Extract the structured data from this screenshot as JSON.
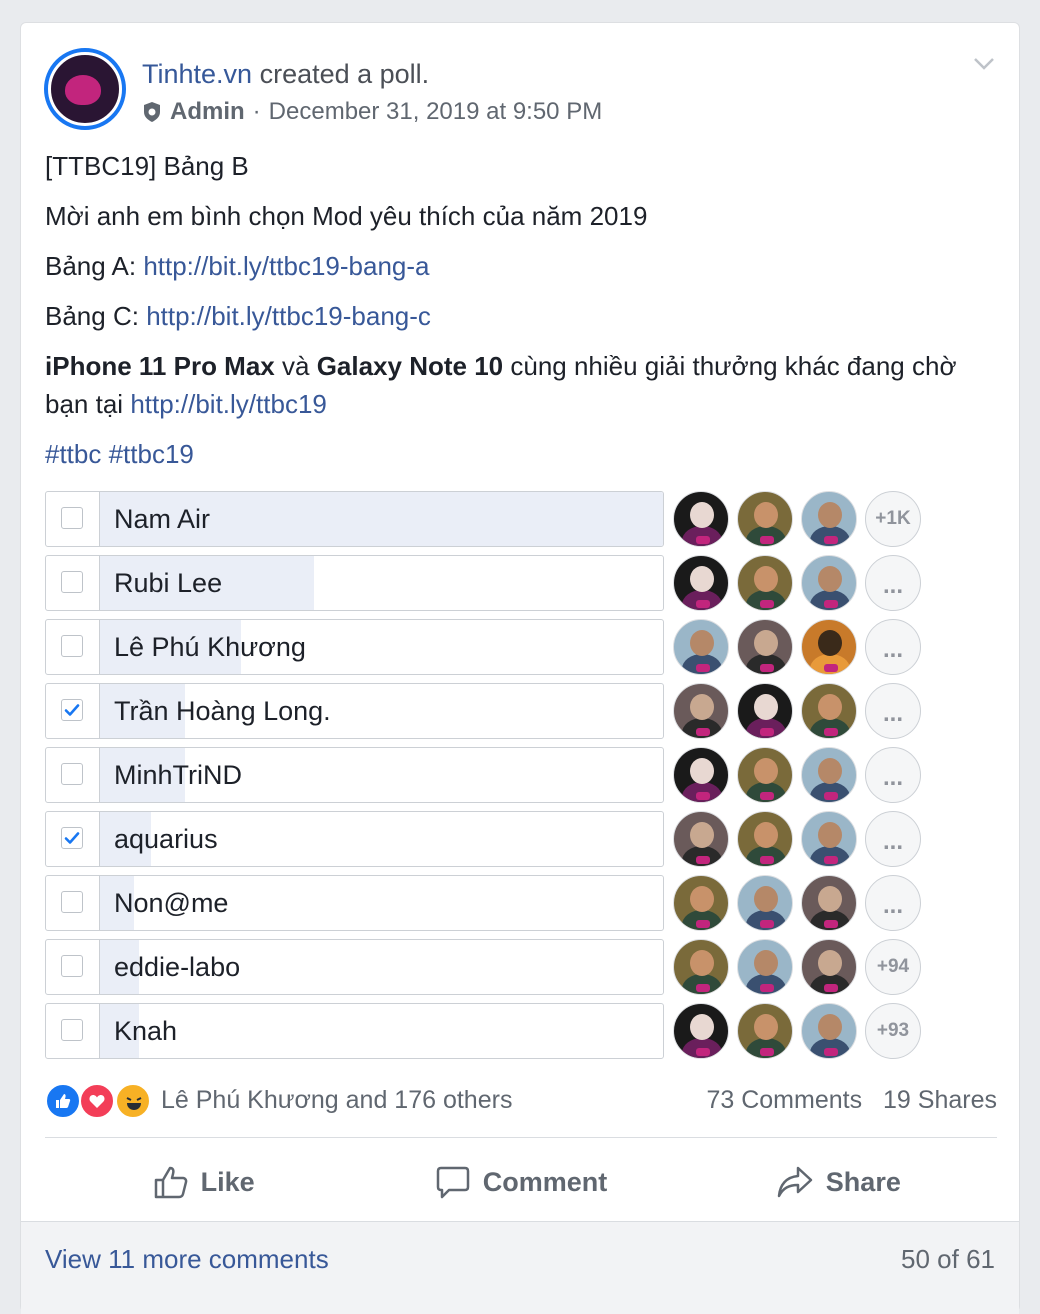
{
  "post": {
    "page_name": "Tinhte.vn",
    "action": "created a poll.",
    "role": "Admin",
    "separator": "·",
    "timestamp": "December 31, 2019 at 9:50 PM",
    "lines": {
      "title": "[TTBC19] Bảng B",
      "intro": "Mời anh em bình chọn Mod yêu thích của năm 2019",
      "bang_a_label": "Bảng A:",
      "bang_a_link": "http://bit.ly/ttbc19-bang-a",
      "bang_c_label": "Bảng C:",
      "bang_c_link": "http://bit.ly/ttbc19-bang-c",
      "prize_bold1": "iPhone 11 Pro Max",
      "prize_and": "và",
      "prize_bold2": "Galaxy Note 10",
      "prize_rest": "cùng nhiều giải thưởng khác đang chờ bạn tại",
      "prize_link": "http://bit.ly/ttbc19",
      "hashtags": "#ttbc #ttbc19"
    }
  },
  "poll": {
    "options": [
      {
        "label": "Nam Air",
        "checked": false,
        "share": 1.0,
        "more": "+1K"
      },
      {
        "label": "Rubi Lee",
        "checked": false,
        "share": 0.38,
        "more": "..."
      },
      {
        "label": "Lê Phú Khương",
        "checked": false,
        "share": 0.25,
        "more": "..."
      },
      {
        "label": "Trần Hoàng Long.",
        "checked": true,
        "share": 0.15,
        "more": "..."
      },
      {
        "label": "MinhTriND",
        "checked": false,
        "share": 0.15,
        "more": "..."
      },
      {
        "label": "aquarius",
        "checked": true,
        "share": 0.09,
        "more": "..."
      },
      {
        "label": "Non@me",
        "checked": false,
        "share": 0.06,
        "more": "..."
      },
      {
        "label": "eddie-labo",
        "checked": false,
        "share": 0.07,
        "more": "+94"
      },
      {
        "label": "Knah",
        "checked": false,
        "share": 0.07,
        "more": "+93"
      }
    ]
  },
  "footer": {
    "reactions_text": "Lê Phú Khương and 176 others",
    "comments_count": "73 Comments",
    "shares_count": "19 Shares",
    "like_label": "Like",
    "comment_label": "Comment",
    "share_label": "Share",
    "view_more": "View 11 more comments",
    "paging": "50 of 61"
  },
  "colors": {
    "accent": "#1877f2",
    "link": "#385898",
    "poll_fill": "#eaeef7"
  }
}
